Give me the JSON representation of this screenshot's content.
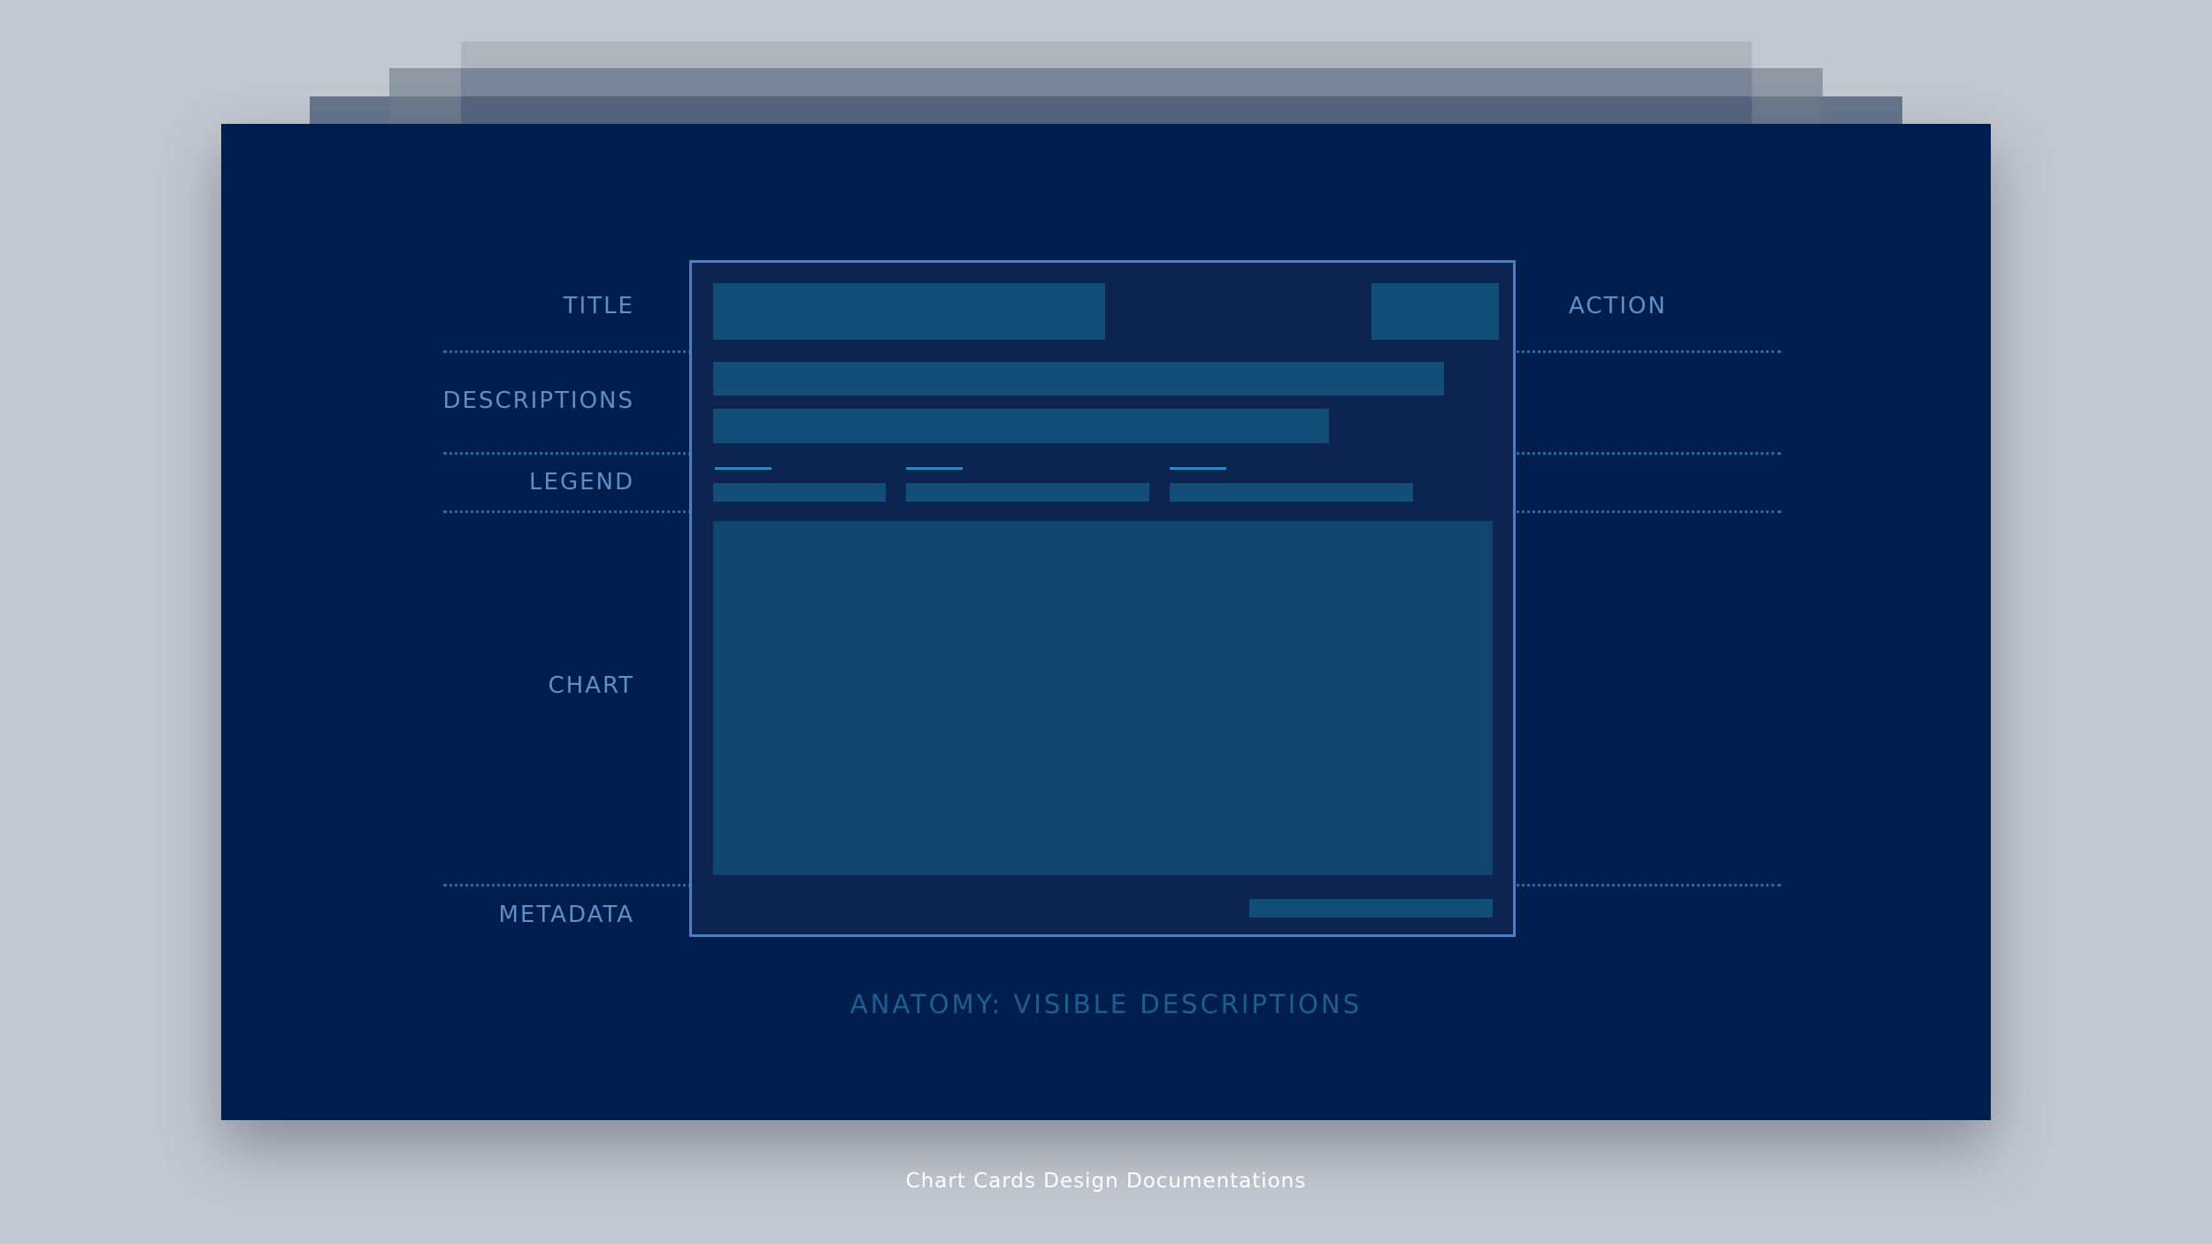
{
  "labels": {
    "title": "TITLE",
    "action": "ACTION",
    "descriptions": "DESCRIPTIONS",
    "legend": "LEGEND",
    "chart": "CHART",
    "metadata": "METADATA"
  },
  "caption": "ANATOMY: VISIBLE DESCRIPTIONS",
  "footer": "Chart Cards Design Documentations",
  "colors": {
    "page_background": "#c3c7cf",
    "card_background": "#001e4d",
    "label_text": "#5f8fc6",
    "card_outline": "#4b7ec3",
    "placeholder_block": "#134e78",
    "divider": "#2c6b99"
  }
}
